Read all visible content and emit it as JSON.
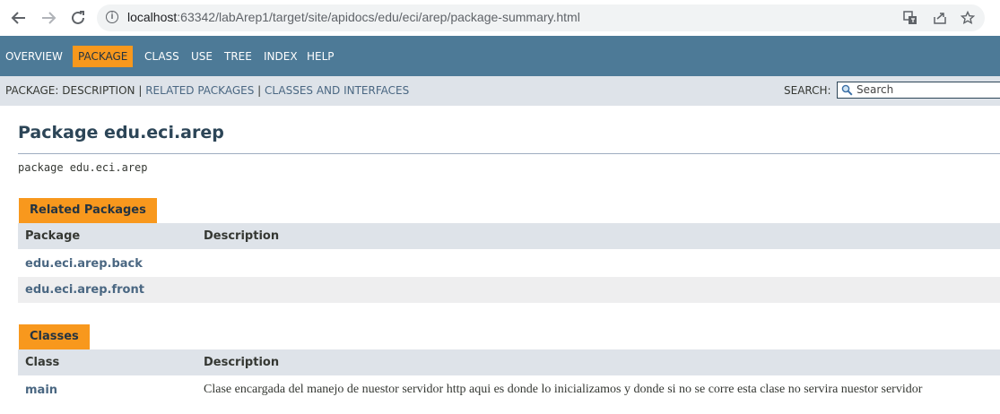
{
  "browser": {
    "url_host": "localhost",
    "url_rest": ":63342/labArep1/target/site/apidocs/edu/eci/arep/package-summary.html",
    "back_icon": "arrow-left-icon",
    "forward_icon": "arrow-right-icon",
    "reload_icon": "reload-icon",
    "translate_icon": "translate-icon",
    "share_icon": "share-icon",
    "bookmark_icon": "star-icon"
  },
  "topnav": {
    "items": [
      "OVERVIEW",
      "PACKAGE",
      "CLASS",
      "USE",
      "TREE",
      "INDEX",
      "HELP"
    ],
    "active": "PACKAGE"
  },
  "subnav": {
    "prefix": "PACKAGE:",
    "description": "DESCRIPTION",
    "related": "RELATED PACKAGES",
    "classes": "CLASSES AND INTERFACES",
    "separator": "|",
    "search_label": "SEARCH:",
    "search_placeholder": "Search"
  },
  "content": {
    "title": "Package edu.eci.arep",
    "declaration": "package edu.eci.arep",
    "related_packages": {
      "caption": "Related Packages",
      "headers": [
        "Package",
        "Description"
      ],
      "rows": [
        {
          "name": "edu.eci.arep.back",
          "description": ""
        },
        {
          "name": "edu.eci.arep.front",
          "description": ""
        }
      ]
    },
    "classes": {
      "caption": "Classes",
      "headers": [
        "Class",
        "Description"
      ],
      "rows": [
        {
          "name": "main",
          "description": "Clase encargada del manejo de nuestor servidor http aqui es donde lo inicializamos y donde si no se corre esta clase no servira nuestor servidor"
        }
      ]
    }
  },
  "colors": {
    "nav_bg": "#4d7a97",
    "active_bg": "#f8981d",
    "subnav_bg": "#dee3e9",
    "link": "#4a6782"
  }
}
